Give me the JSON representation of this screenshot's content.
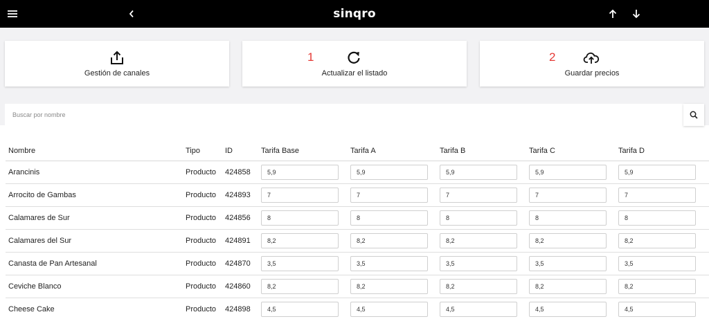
{
  "app": {
    "logo": "sinqro"
  },
  "icons": {
    "menu": "menu-icon",
    "back": "chevron-left-icon",
    "up": "arrow-up-icon",
    "down": "arrow-down-icon",
    "share": "share-icon",
    "refresh": "refresh-icon",
    "cloud": "cloud-upload-icon",
    "search": "search-icon"
  },
  "actions": {
    "channels_label": "Gestión de canales",
    "refresh_label": "Actualizar el listado",
    "refresh_badge": "1",
    "save_label": "Guardar precios",
    "save_badge": "2"
  },
  "colors": {
    "topbar": "#000000",
    "badge": "#e53935",
    "background": "#f2f2f4"
  },
  "search": {
    "placeholder": "Buscar por nombre"
  },
  "table": {
    "headers": [
      "Nombre",
      "Tipo",
      "ID",
      "Tarifa Base",
      "Tarifa A",
      "Tarifa B",
      "Tarifa C",
      "Tarifa D"
    ],
    "rows": [
      {
        "name": "Arancinis",
        "type": "Producto",
        "id": "424858",
        "prices": [
          "5,9",
          "5,9",
          "5,9",
          "5,9",
          "5,9"
        ]
      },
      {
        "name": "Arrocito de Gambas",
        "type": "Producto",
        "id": "424893",
        "prices": [
          "7",
          "7",
          "7",
          "7",
          "7"
        ]
      },
      {
        "name": "Calamares de Sur",
        "type": "Producto",
        "id": "424856",
        "prices": [
          "8",
          "8",
          "8",
          "8",
          "8"
        ]
      },
      {
        "name": "Calamares del Sur",
        "type": "Producto",
        "id": "424891",
        "prices": [
          "8,2",
          "8,2",
          "8,2",
          "8,2",
          "8,2"
        ]
      },
      {
        "name": "Canasta de Pan Artesanal",
        "type": "Producto",
        "id": "424870",
        "prices": [
          "3,5",
          "3,5",
          "3,5",
          "3,5",
          "3,5"
        ]
      },
      {
        "name": "Ceviche Blanco",
        "type": "Producto",
        "id": "424860",
        "prices": [
          "8,2",
          "8,2",
          "8,2",
          "8,2",
          "8,2"
        ]
      },
      {
        "name": "Cheese Cake",
        "type": "Producto",
        "id": "424898",
        "prices": [
          "4,5",
          "4,5",
          "4,5",
          "4,5",
          "4,5"
        ]
      }
    ]
  }
}
